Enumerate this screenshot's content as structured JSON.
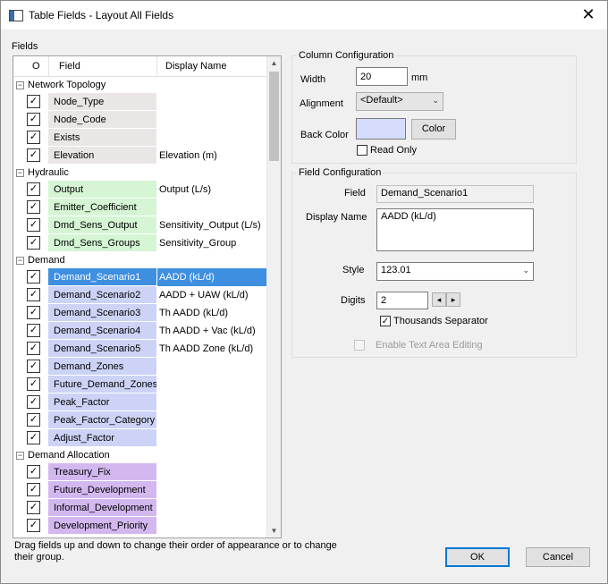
{
  "window": {
    "title": "Table Fields - Layout All Fields",
    "close_glyph": "✕"
  },
  "fields_label": "Fields",
  "grid": {
    "col_o": "O",
    "col_field": "Field",
    "col_display": "Display Name",
    "groups": [
      {
        "name": "Network Topology",
        "color": "#ebe6e6",
        "rows": [
          {
            "field": "Node_Type",
            "display": ""
          },
          {
            "field": "Node_Code",
            "display": ""
          },
          {
            "field": "Exists",
            "display": ""
          },
          {
            "field": "Elevation",
            "display": "Elevation (m)"
          }
        ]
      },
      {
        "name": "Hydraulic",
        "color": "#d5f5d5",
        "rows": [
          {
            "field": "Output",
            "display": "Output (L/s)"
          },
          {
            "field": "Emitter_Coefficient",
            "display": ""
          },
          {
            "field": "Dmd_Sens_Output",
            "display": "Sensitivity_Output (L/s)"
          },
          {
            "field": "Dmd_Sens_Groups",
            "display": "Sensitivity_Group"
          }
        ]
      },
      {
        "name": "Demand",
        "color": "#ccd3f6",
        "rows": [
          {
            "field": "Demand_Scenario1",
            "display": "AADD (kL/d)",
            "selected": true
          },
          {
            "field": "Demand_Scenario2",
            "display": "AADD + UAW (kL/d)"
          },
          {
            "field": "Demand_Scenario3",
            "display": "Th AADD (kL/d)"
          },
          {
            "field": "Demand_Scenario4",
            "display": "Th AADD + Vac (kL/d)"
          },
          {
            "field": "Demand_Scenario5",
            "display": "Th AADD Zone (kL/d)"
          },
          {
            "field": "Demand_Zones",
            "display": ""
          },
          {
            "field": "Future_Demand_Zones",
            "display": ""
          },
          {
            "field": "Peak_Factor",
            "display": ""
          },
          {
            "field": "Peak_Factor_Category",
            "display": ""
          },
          {
            "field": "Adjust_Factor",
            "display": ""
          }
        ]
      },
      {
        "name": "Demand Allocation",
        "color": "#d3b8f0",
        "rows": [
          {
            "field": "Treasury_Fix",
            "display": ""
          },
          {
            "field": "Future_Development",
            "display": ""
          },
          {
            "field": "Informal_Development",
            "display": ""
          },
          {
            "field": "Development_Priority",
            "display": ""
          }
        ]
      }
    ]
  },
  "hint": "Drag fields up and down to change their order of appearance or to change their group.",
  "column_config": {
    "legend": "Column Configuration",
    "width_label": "Width",
    "width_value": "20",
    "width_unit": "mm",
    "alignment_label": "Alignment",
    "alignment_value": "<Default>",
    "back_color_label": "Back Color",
    "back_color_value": "#d6dcfb",
    "color_button": "Color",
    "read_only_label": "Read Only",
    "read_only_checked": false
  },
  "field_config": {
    "legend": "Field Configuration",
    "field_label": "Field",
    "field_value": "Demand_Scenario1",
    "display_name_label": "Display Name",
    "display_name_value": "AADD (kL/d)",
    "style_label": "Style",
    "style_value": "123.01",
    "digits_label": "Digits",
    "digits_value": "2",
    "thousands_label": "Thousands Separator",
    "thousands_checked": true,
    "text_area_label": "Enable Text Area Editing",
    "text_area_checked": false
  },
  "buttons": {
    "ok": "OK",
    "cancel": "Cancel"
  },
  "icons": {
    "check": "✓",
    "expand": "−",
    "dropdown": "⌄",
    "scroll_up": "▲",
    "scroll_down": "▼",
    "spin_left": "◂",
    "spin_right": "▸"
  }
}
